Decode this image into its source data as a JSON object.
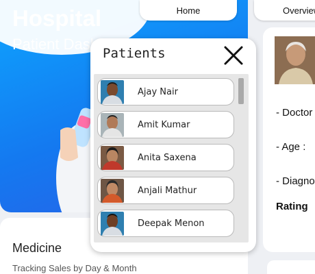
{
  "hero": {
    "title": "Hospital",
    "subtitle": "Patient Dashboard"
  },
  "nav": {
    "home": "Home",
    "overview": "Overview"
  },
  "medicine": {
    "title": "Medicine",
    "subtitle": "Tracking Sales by Day & Month"
  },
  "doctor_panel": {
    "doctor_label": "- Doctor",
    "age_label": "- Age :",
    "diagnosis_label": "- Diagnosis",
    "rating_label": "Rating"
  },
  "popup": {
    "title": "Patients",
    "patients": [
      {
        "name": "Ajay Nair"
      },
      {
        "name": "Amit Kumar"
      },
      {
        "name": "Anita Saxena"
      },
      {
        "name": "Anjali Mathur"
      },
      {
        "name": "Deepak Menon"
      }
    ]
  },
  "icons": {
    "close": "close-icon"
  },
  "colors": {
    "accent": "#1479f0",
    "accent_light": "#0ea5ff"
  }
}
